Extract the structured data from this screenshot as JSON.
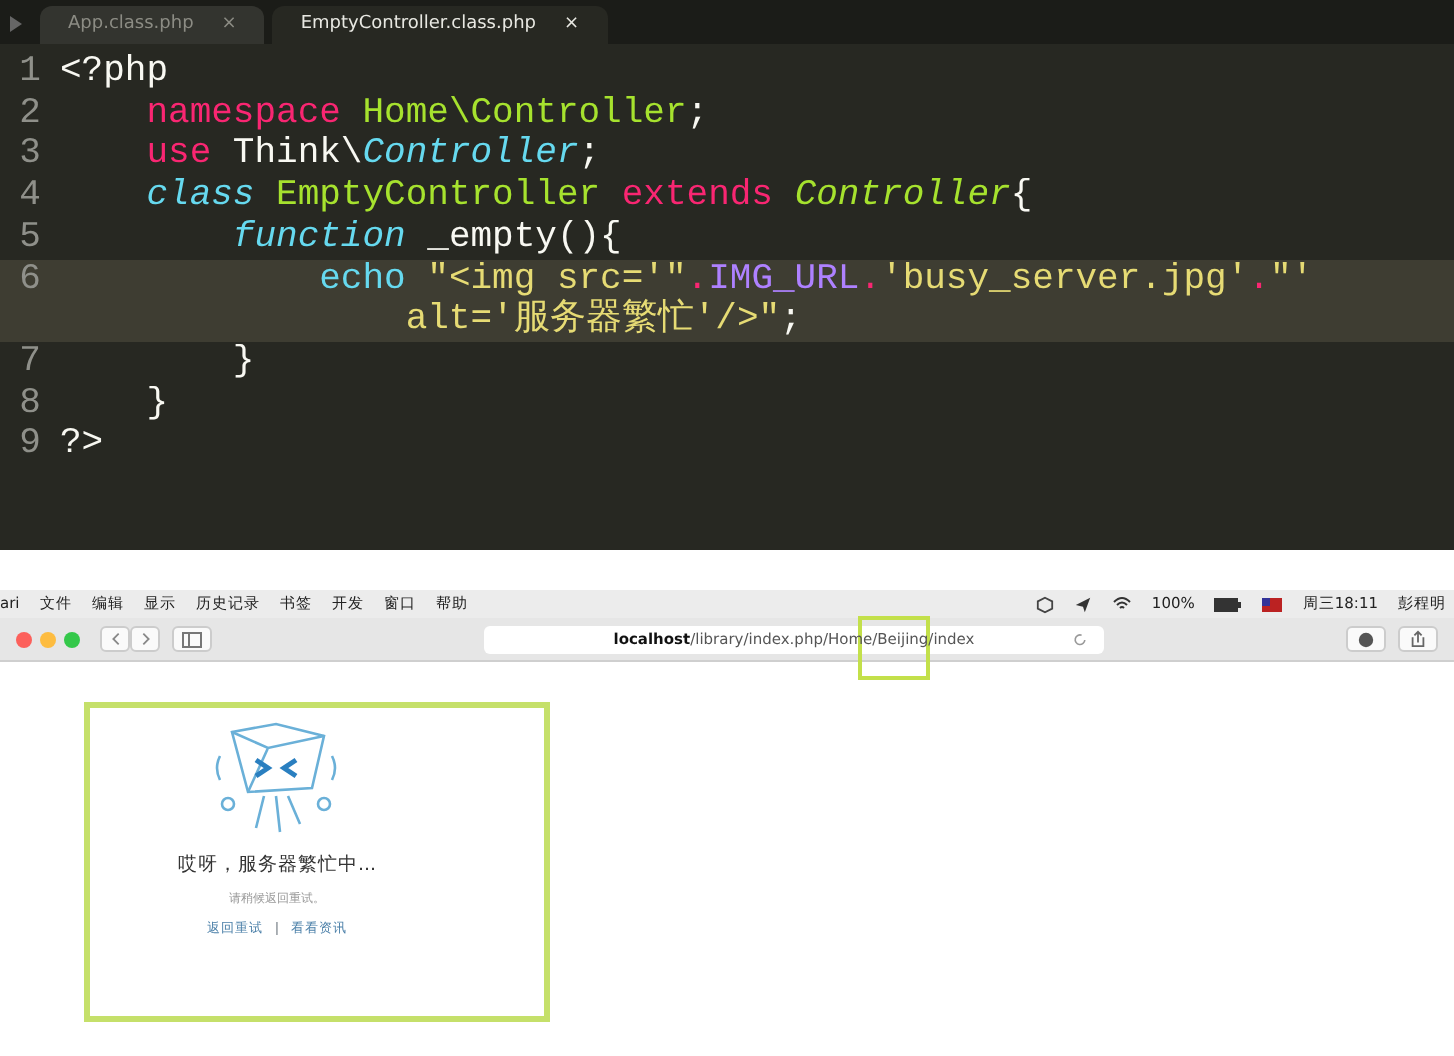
{
  "editor": {
    "tabs": [
      {
        "label": "App.class.php",
        "close": "×",
        "selected": false
      },
      {
        "label": "EmptyController.class.php",
        "close": "×",
        "selected": true
      }
    ],
    "lines": [
      {
        "number": "1",
        "highlighted": false,
        "rows": [
          [
            {
              "text": "<?php",
              "kind": "plain"
            }
          ]
        ]
      },
      {
        "number": "2",
        "highlighted": false,
        "rows": [
          [
            {
              "text": "    ",
              "kind": "plain"
            },
            {
              "text": "namespace",
              "kind": "keyword"
            },
            {
              "text": " Home\\Controller",
              "kind": "name"
            },
            {
              "text": ";",
              "kind": "plain"
            }
          ]
        ]
      },
      {
        "number": "3",
        "highlighted": false,
        "rows": [
          [
            {
              "text": "    ",
              "kind": "plain"
            },
            {
              "text": "use",
              "kind": "keyword"
            },
            {
              "text": " Think\\",
              "kind": "plain"
            },
            {
              "text": "Controller",
              "kind": "storage"
            },
            {
              "text": ";",
              "kind": "plain"
            }
          ]
        ]
      },
      {
        "number": "4",
        "highlighted": false,
        "rows": [
          [
            {
              "text": "    ",
              "kind": "plain"
            },
            {
              "text": "class",
              "kind": "storage"
            },
            {
              "text": " EmptyController ",
              "kind": "name"
            },
            {
              "text": "extends",
              "kind": "keyword"
            },
            {
              "text": " ",
              "kind": "plain"
            },
            {
              "text": "Controller",
              "kind": "type"
            },
            {
              "text": "{",
              "kind": "plain"
            }
          ]
        ]
      },
      {
        "number": "5",
        "highlighted": false,
        "rows": [
          [
            {
              "text": "        ",
              "kind": "plain"
            },
            {
              "text": "function",
              "kind": "storage"
            },
            {
              "text": " _empty(){",
              "kind": "plain"
            }
          ]
        ]
      },
      {
        "number": "6",
        "highlighted": true,
        "rows": [
          [
            {
              "text": "            ",
              "kind": "plain"
            },
            {
              "text": "echo",
              "kind": "support"
            },
            {
              "text": " \"<img src='\"",
              "kind": "string"
            },
            {
              "text": ".",
              "kind": "keyword"
            },
            {
              "text": "IMG_URL",
              "kind": "constant"
            },
            {
              "text": ".",
              "kind": "keyword"
            },
            {
              "text": "'busy_server.jpg'",
              "kind": "string"
            },
            {
              "text": ".",
              "kind": "keyword"
            },
            {
              "text": "\"' alt='服务器繁忙'/>\"",
              "kind": "string"
            },
            {
              "text": ";",
              "kind": "plain"
            }
          ]
        ]
      },
      {
        "number": "7",
        "highlighted": false,
        "rows": [
          [
            {
              "text": "        }",
              "kind": "plain"
            }
          ]
        ]
      },
      {
        "number": "8",
        "highlighted": false,
        "rows": [
          [
            {
              "text": "    }",
              "kind": "plain"
            }
          ]
        ]
      },
      {
        "number": "9",
        "highlighted": false,
        "rows": [
          [
            {
              "text": "?>",
              "kind": "plain"
            }
          ]
        ]
      }
    ]
  },
  "browser": {
    "menu_bar": {
      "app": "ari",
      "items": [
        "文件",
        "编辑",
        "显示",
        "历史记录",
        "书签",
        "开发",
        "窗口",
        "帮助"
      ],
      "battery": "100%",
      "datetime": "周三18:11",
      "user": "彭程明"
    },
    "address": "**localhost**/library/index.php/Home/Beijing/index",
    "highlight_box": true,
    "error_page": {
      "title": "哎呀，服务器繁忙中...",
      "subtitle": "请稍候返回重试。",
      "links": [
        "返回重试",
        "看看资讯"
      ],
      "separator": "|"
    }
  }
}
